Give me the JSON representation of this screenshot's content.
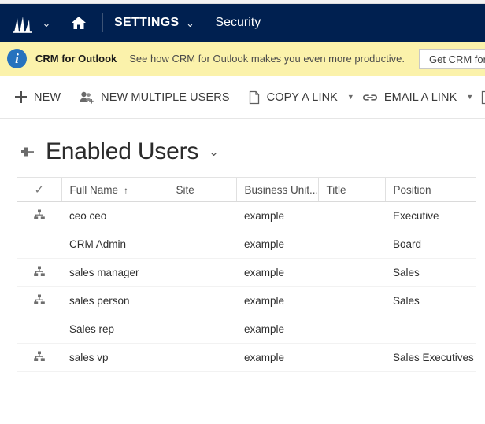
{
  "navbar": {
    "logo_icon": "dynamics-crm-logo-icon",
    "logo_chevron": "⌄",
    "home_icon": "home-icon",
    "app_title": "SETTINGS",
    "app_chevron": "⌄",
    "entity_title": "Security"
  },
  "notification": {
    "icon": "info-icon",
    "icon_glyph": "i",
    "title": "CRM for Outlook",
    "message": "See how CRM for Outlook makes you even more productive.",
    "button_label": "Get CRM for",
    "background_color": "#fbf2ab",
    "icon_color": "#2672be"
  },
  "command_bar": {
    "commands": [
      {
        "label": "NEW",
        "icon": "plus-icon",
        "has_caret": false
      },
      {
        "label": "NEW MULTIPLE USERS",
        "icon": "add-users-icon",
        "has_caret": false
      },
      {
        "label": "COPY A LINK",
        "icon": "document-icon",
        "has_caret": true,
        "caret": "▼"
      },
      {
        "label": "EMAIL A LINK",
        "icon": "link-icon",
        "has_caret": true,
        "caret": "▼"
      }
    ],
    "clipped_icon": "document-icon-clipped"
  },
  "view": {
    "pin_icon": "pin-icon",
    "title": "Enabled Users",
    "chevron": "⌄"
  },
  "grid": {
    "columns": [
      {
        "key": "check",
        "label": "✓",
        "icon": "checkmark-icon",
        "sorted": false
      },
      {
        "key": "full_name",
        "label": "Full Name",
        "sorted": true,
        "sort_arrow": "↑"
      },
      {
        "key": "site",
        "label": "Site",
        "sorted": false
      },
      {
        "key": "business_unit",
        "label": "Business Unit...",
        "sorted": false
      },
      {
        "key": "title",
        "label": "Title",
        "sorted": false
      },
      {
        "key": "position",
        "label": "Position",
        "sorted": false
      }
    ],
    "rows": [
      {
        "icon": "hierarchy-icon",
        "full_name": "ceo ceo",
        "site": "",
        "business_unit": "example",
        "title": "",
        "position": "Executive"
      },
      {
        "icon": "",
        "full_name": "CRM Admin",
        "site": "",
        "business_unit": "example",
        "title": "",
        "position": "Board"
      },
      {
        "icon": "hierarchy-icon",
        "full_name": "sales manager",
        "site": "",
        "business_unit": "example",
        "title": "",
        "position": "Sales"
      },
      {
        "icon": "hierarchy-icon",
        "full_name": "sales person",
        "site": "",
        "business_unit": "example",
        "title": "",
        "position": "Sales"
      },
      {
        "icon": "",
        "full_name": "Sales rep",
        "site": "",
        "business_unit": "example",
        "title": "",
        "position": ""
      },
      {
        "icon": "hierarchy-icon",
        "full_name": "sales vp",
        "site": "",
        "business_unit": "example",
        "title": "",
        "position": "Sales Executives"
      }
    ]
  },
  "colors": {
    "navbar": "#002050",
    "notify_bg": "#fbf2ab",
    "accent_blue": "#2672be"
  }
}
